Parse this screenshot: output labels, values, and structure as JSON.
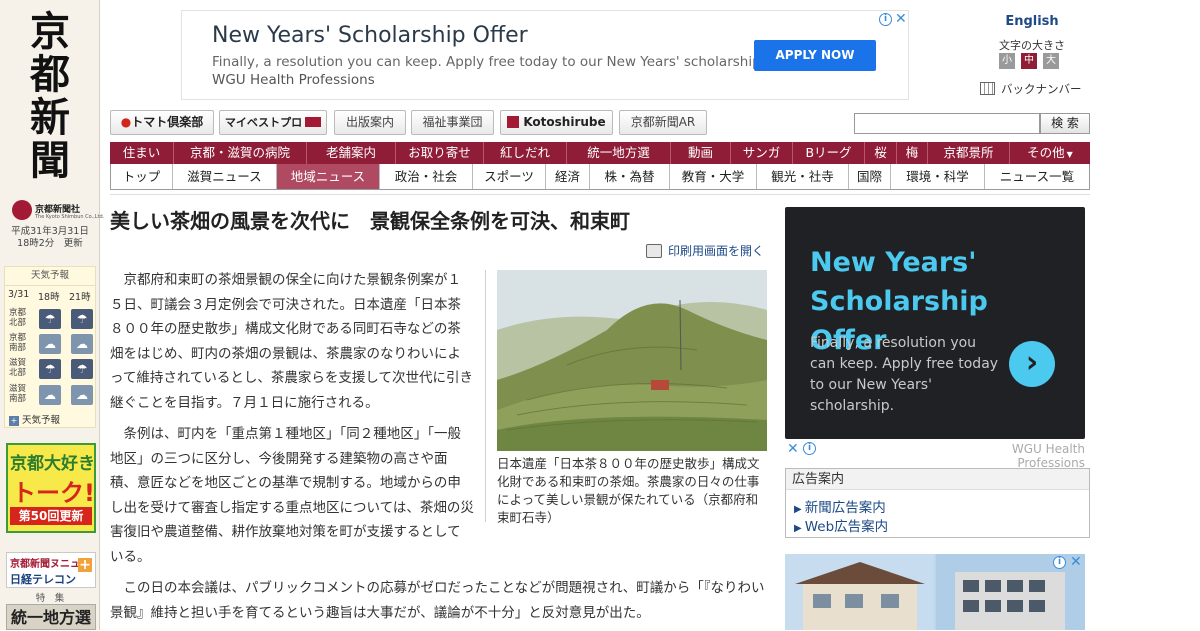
{
  "sidebar": {
    "logo": [
      "京",
      "都",
      "新",
      "聞"
    ],
    "brand_name": "京都新聞社",
    "brand_sub": "The Kyoto Shimbun Co.,Ltd.",
    "update_line1": "平成31年3月31日",
    "update_line2": "18時2分　更新",
    "weather": {
      "title": "天気予報",
      "headers": [
        "3/31",
        "18時",
        "21時"
      ],
      "rows": [
        {
          "name1": "京都",
          "name2": "北部",
          "icon1": "umbrella",
          "icon2": "umbrella"
        },
        {
          "name1": "京都",
          "name2": "南部",
          "icon1": "cloud",
          "icon2": "cloud"
        },
        {
          "name1": "滋賀",
          "name2": "北部",
          "icon1": "umbrella",
          "icon2": "umbrella"
        },
        {
          "name1": "滋賀",
          "name2": "南部",
          "icon1": "cloud",
          "icon2": "cloud"
        }
      ],
      "link": "天気予報"
    },
    "talk_banner": {
      "line1": "京都大好き",
      "line2": "トーク!",
      "line3": "第50回更新"
    },
    "nikkei_banner": {
      "line1": "京都新聞ヌニュ",
      "line2": "日経テレコン"
    },
    "tokushu_label": "特　集",
    "tokushu_box": "統一地方選"
  },
  "top_ad": {
    "title": "New Years' Scholarship Offer",
    "desc": "Finally, a resolution you can keep. Apply free today to our New Years' scholarship.",
    "source": "WGU Health Professions",
    "button": "APPLY NOW"
  },
  "utilities": {
    "language": "English",
    "fontsize_label": "文字の大きさ",
    "fontsizes": [
      "小",
      "中",
      "大"
    ],
    "backnumber": "バックナンバー"
  },
  "linkbar": {
    "items": [
      "トマト倶楽部",
      "マイベストプロ",
      "出版案内",
      "福祉事業団",
      "Kotoshirube",
      "京都新聞AR"
    ],
    "search_button": "検 索"
  },
  "nav_primary": [
    "住まい",
    "京都・滋賀の病院",
    "老舗案内",
    "お取り寄せ",
    "紅しだれ",
    "統一地方選",
    "動画",
    "サンガ",
    "Bリーグ",
    "桜",
    "梅",
    "京都景所",
    "その他"
  ],
  "nav_secondary": [
    "トップ",
    "滋賀ニュース",
    "地域ニュース",
    "政治・社会",
    "スポーツ",
    "経済",
    "株・為替",
    "教育・大学",
    "観光・社寺",
    "国際",
    "環境・科学",
    "ニュース一覧"
  ],
  "nav_secondary_active": "地域ニュース",
  "article": {
    "headline": "美しい茶畑の風景を次代に　景観保全条例を可決、和束町",
    "print_link": "印刷用画面を開く",
    "para1": "京都府和束町の茶畑景観の保全に向けた景観条例案が１５日、町議会３月定例会で可決された。日本遺産「日本茶８００年の歴史散歩」構成文化財である同町石寺などの茶畑をはじめ、町内の茶畑の景観は、茶農家のなりわいによって維持されているとし、茶農家らを支援して次世代に引き継ぐことを目指す。７月１日に施行される。",
    "para2": "条例は、町内を「重点第１種地区」「同２種地区」「一般地区」の三つに区分し、今後開発する建築物の高さや面積、意匠などを地区ごとの基準で規制する。地域からの申し出を受けて審査し指定する重点地区については、茶畑の災害復旧や農道整備、耕作放棄地対策を町が支援するとしている。",
    "para3": "この日の本会議は、パブリックコメントの応募がゼロだったことなどが問題視され、町議から「『なりわい景観』維持と担い手を育てるという趣旨は大事だが、議論が不十分」と反対意見が出た。",
    "caption": "日本遺産「日本茶８００年の歴史散歩」構成文化財である和束町の茶畑。茶農家の日々の仕事によって美しい景観が保たれている（京都府和束町石寺）"
  },
  "side_ad": {
    "title": "New Years' Scholarship Offer",
    "desc": "Finally, a resolution you can keep. Apply free today to our New Years' scholarship.",
    "source": "WGU Health Professions"
  },
  "ad_info": {
    "title": "広告案内",
    "links": [
      "新聞広告案内",
      "Web広告案内"
    ]
  },
  "colors": {
    "brand": "#8f1d37",
    "active_tab": "#b04a63",
    "link": "#1d4a87",
    "ad_accent": "#4cc9ef"
  }
}
